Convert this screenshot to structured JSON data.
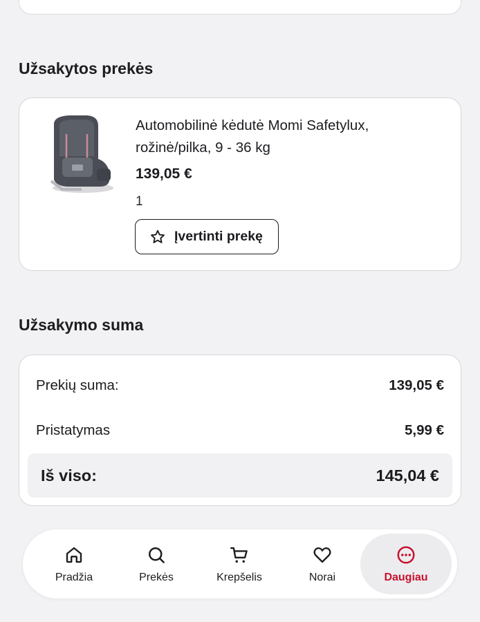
{
  "ordered_items": {
    "title": "Užsakytos prekės",
    "items": [
      {
        "name": "Automobilinė kėdutė Momi Safetylux, rožinė/pilka, 9 - 36 kg",
        "price": "139,05 €",
        "quantity": "1",
        "rate_label": "Įvertinti prekę",
        "image_icon": "car-seat"
      }
    ]
  },
  "order_summary": {
    "title": "Užsakymo suma",
    "rows": [
      {
        "label": "Prekių suma:",
        "value": "139,05 €"
      },
      {
        "label": "Pristatymas",
        "value": "5,99 €"
      }
    ],
    "total": {
      "label": "Iš viso:",
      "value": "145,04 €"
    }
  },
  "nav": {
    "items": [
      {
        "label": "Pradžia",
        "icon": "home-icon"
      },
      {
        "label": "Prekės",
        "icon": "search-icon"
      },
      {
        "label": "Krepšelis",
        "icon": "cart-icon"
      },
      {
        "label": "Norai",
        "icon": "heart-icon"
      },
      {
        "label": "Daugiau",
        "icon": "more-icon",
        "active": true
      }
    ]
  },
  "colors": {
    "accent": "#c8102e",
    "background": "#f2f2f4",
    "card": "#ffffff"
  }
}
